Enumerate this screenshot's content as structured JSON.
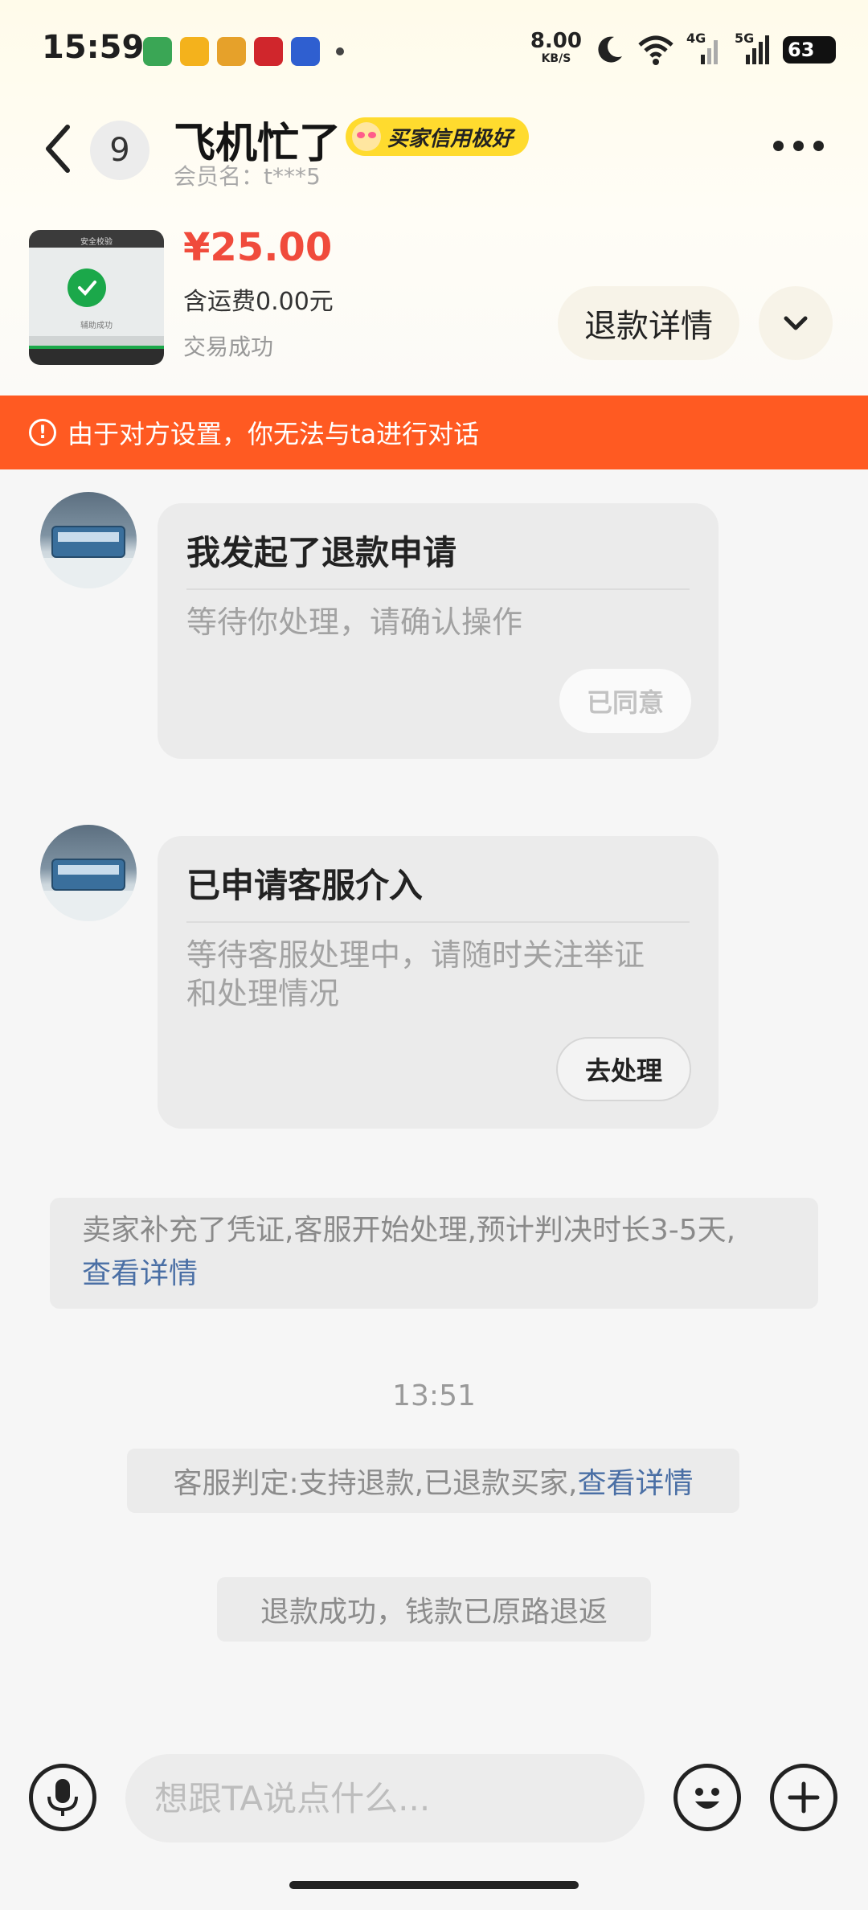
{
  "status_bar": {
    "time": "15:59",
    "network_speed": "8.00",
    "network_speed_unit": "KB/S",
    "signal_labels": [
      "4G",
      "5G"
    ],
    "battery": "63"
  },
  "header": {
    "unread_count": "9",
    "contact_name": "飞机忙了",
    "credit_badge": "买家信用极好",
    "member_label": "会员名：t***5"
  },
  "product": {
    "price": "¥25.00",
    "shipping": "含运费0.00元",
    "status": "交易成功",
    "thumb_title": "安全校验",
    "thumb_text": "辅助成功",
    "refund_button": "退款详情"
  },
  "alert": {
    "icon": "!",
    "text": "由于对方设置，你无法与ta进行对话"
  },
  "messages": [
    {
      "title": "我发起了退款申请",
      "desc": "等待你处理，请确认操作",
      "button": "已同意"
    },
    {
      "title": "已申请客服介入",
      "desc": "等待客服处理中，请随时关注举证和处理情况",
      "button": "去处理"
    }
  ],
  "system_notice": {
    "text": "卖家补充了凭证,客服开始处理,预计判决时长3-5天,",
    "link": "查看详情"
  },
  "timestamp": "13:51",
  "verdict": {
    "text": "客服判定:支持退款,已退款买家,",
    "link": "查看详情"
  },
  "refund_done": "退款成功，钱款已原路退返",
  "input": {
    "placeholder": "想跟TA说点什么..."
  },
  "colors": {
    "accent_orange": "#ff5a22",
    "price_red": "#f04b3c",
    "badge_yellow": "#ffdb2e",
    "link_blue": "#4a6fa5"
  }
}
